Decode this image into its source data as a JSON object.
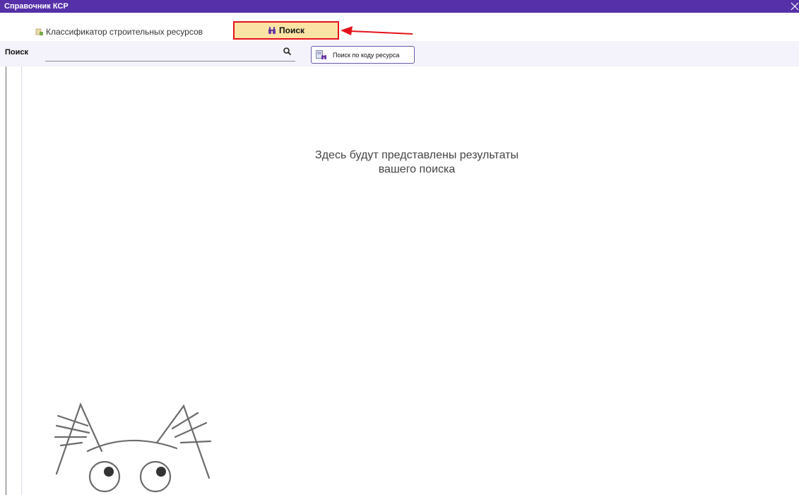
{
  "window": {
    "title": "Справочник КСР",
    "close_icon": "close-icon"
  },
  "tabs": {
    "classifier": {
      "label": "Классификатор строительных ресурсов",
      "icon": "classifier-icon"
    },
    "search": {
      "label": "Поиск",
      "icon": "binoculars-icon",
      "selected": true
    }
  },
  "toolbar": {
    "search_label": "Поиск",
    "search_value": "",
    "search_icon": "search-icon",
    "code_search_button": "Поиск по коду ресурса",
    "code_search_icon": "code-search-icon"
  },
  "main": {
    "empty_line1": "Здесь будут представлены результаты",
    "empty_line2": "вашего поиска"
  },
  "colors": {
    "titlebar": "#5530a8",
    "selected_tab": "#fbe3a5",
    "highlight": "#e5121b",
    "toolbar_bg": "#f4f3fb"
  }
}
